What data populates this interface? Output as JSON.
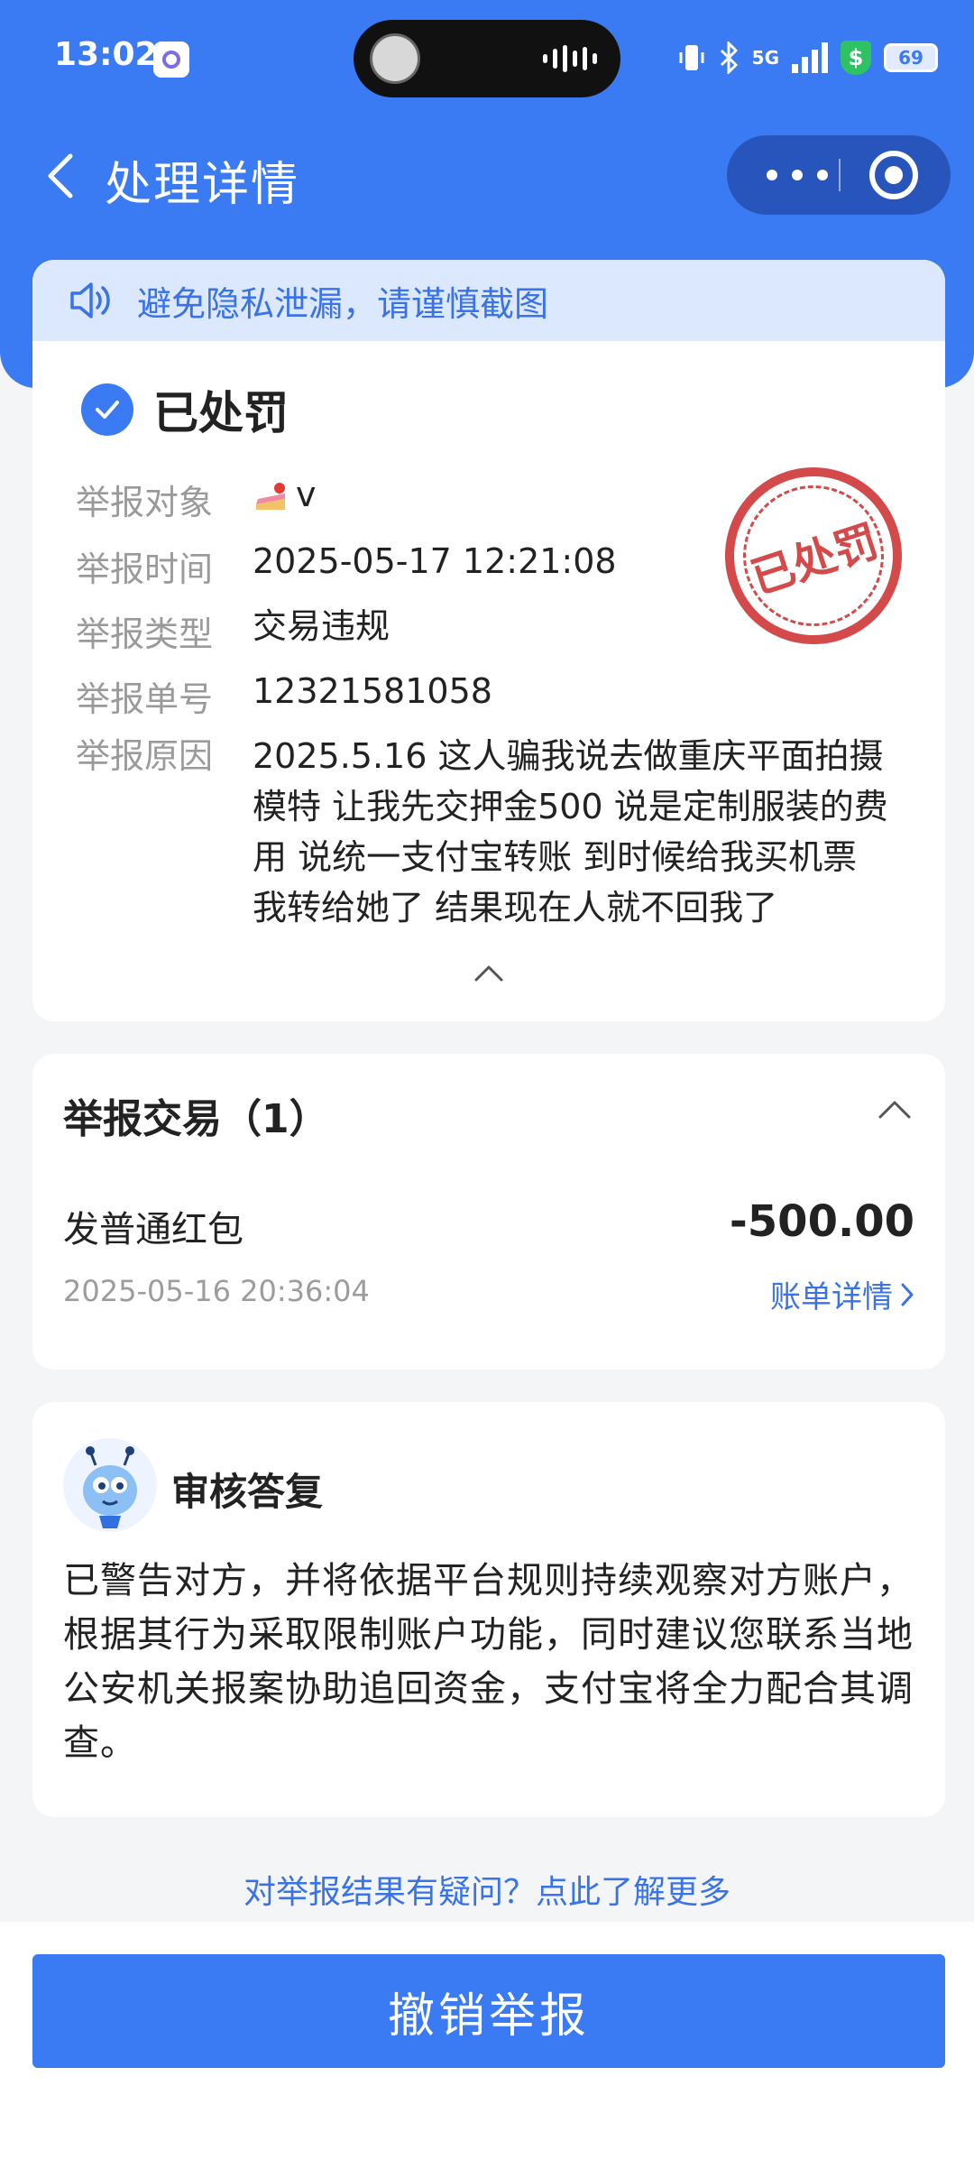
{
  "status_bar": {
    "time": "13:02",
    "battery": "69",
    "network": "5G"
  },
  "nav": {
    "title": "处理详情"
  },
  "privacy_notice": "避免隐私泄漏，请谨慎截图",
  "report": {
    "status": "已处罚",
    "stamp_text": "已处罚",
    "fields": {
      "target_label": "举报对象",
      "target_value": "v",
      "time_label": "举报时间",
      "time_value": "2025-05-17 12:21:08",
      "type_label": "举报类型",
      "type_value": "交易违规",
      "number_label": "举报单号",
      "number_value": "12321581058",
      "reason_label": "举报原因",
      "reason_value": "2025.5.16 这人骗我说去做重庆平面拍摄模特 让我先交押金500 说是定制服装的费用 说统一支付宝转账 到时候给我买机票 我转给她了 结果现在人就不回我了"
    }
  },
  "transactions": {
    "title": "举报交易（1）",
    "items": [
      {
        "name": "发普通红包",
        "amount": "-500.00",
        "time": "2025-05-16 20:36:04",
        "link": "账单详情"
      }
    ]
  },
  "review": {
    "title": "审核答复",
    "text": "已警告对方，并将依据平台规则持续观察对方账户，根据其行为采取限制账户功能，同时建议您联系当地公安机关报案协助追回资金，支付宝将全力配合其调查。"
  },
  "help_link": "对举报结果有疑问？点此了解更多",
  "cancel_button": "撤销举报",
  "colors": {
    "primary": "#3a7af2",
    "stamp": "#d44a4a",
    "notice_bg": "#dce8fd"
  }
}
